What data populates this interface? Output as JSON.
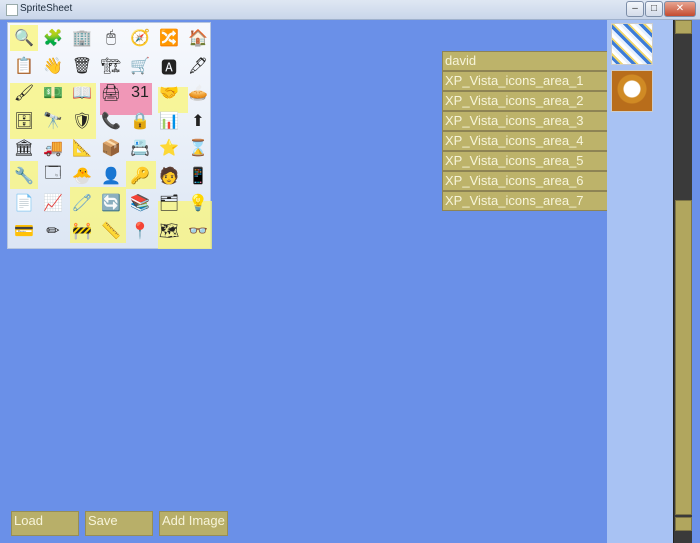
{
  "window": {
    "title": "SpriteSheet",
    "controls": {
      "minimize": "–",
      "maximize": "□",
      "close": "✕"
    }
  },
  "sprite_sheet": {
    "icons": [
      "🔍",
      "🧩",
      "🏢",
      "🖱",
      "🧭",
      "🔀",
      "🏠",
      "📋",
      "👋",
      "🗑",
      "🏗",
      "🛒",
      "🅰",
      "🖋",
      "🖌",
      "💵",
      "📖",
      "🖨",
      "31",
      "🤝",
      "🥧",
      "🗄",
      "🔭",
      "🛡",
      "📞",
      "🔒",
      "📊",
      "⬆",
      "🏛",
      "🚚",
      "📐",
      "📦",
      "📇",
      "⭐",
      "⌛",
      "🔧",
      "🗔",
      "🐣",
      "👤",
      "🔑",
      "🧑",
      "📱",
      "📄",
      "📈",
      "🧷",
      "🔄",
      "📚",
      "🗂",
      "💡",
      "💳",
      "✏",
      "🚧",
      "📏",
      "📍",
      "🗺",
      "👓"
    ]
  },
  "sprite_list": [
    "david",
    "XP_Vista_icons_area_1",
    "XP_Vista_icons_area_2",
    "XP_Vista_icons_area_3",
    "XP_Vista_icons_area_4",
    "XP_Vista_icons_area_5",
    "XP_Vista_icons_area_6",
    "XP_Vista_icons_area_7"
  ],
  "buttons": {
    "load": "Load",
    "save": "Save",
    "add_image": "Add Image"
  },
  "colors": {
    "background": "#6a90e8",
    "item": "#bdb36a",
    "panel": "#a8c2f3"
  }
}
